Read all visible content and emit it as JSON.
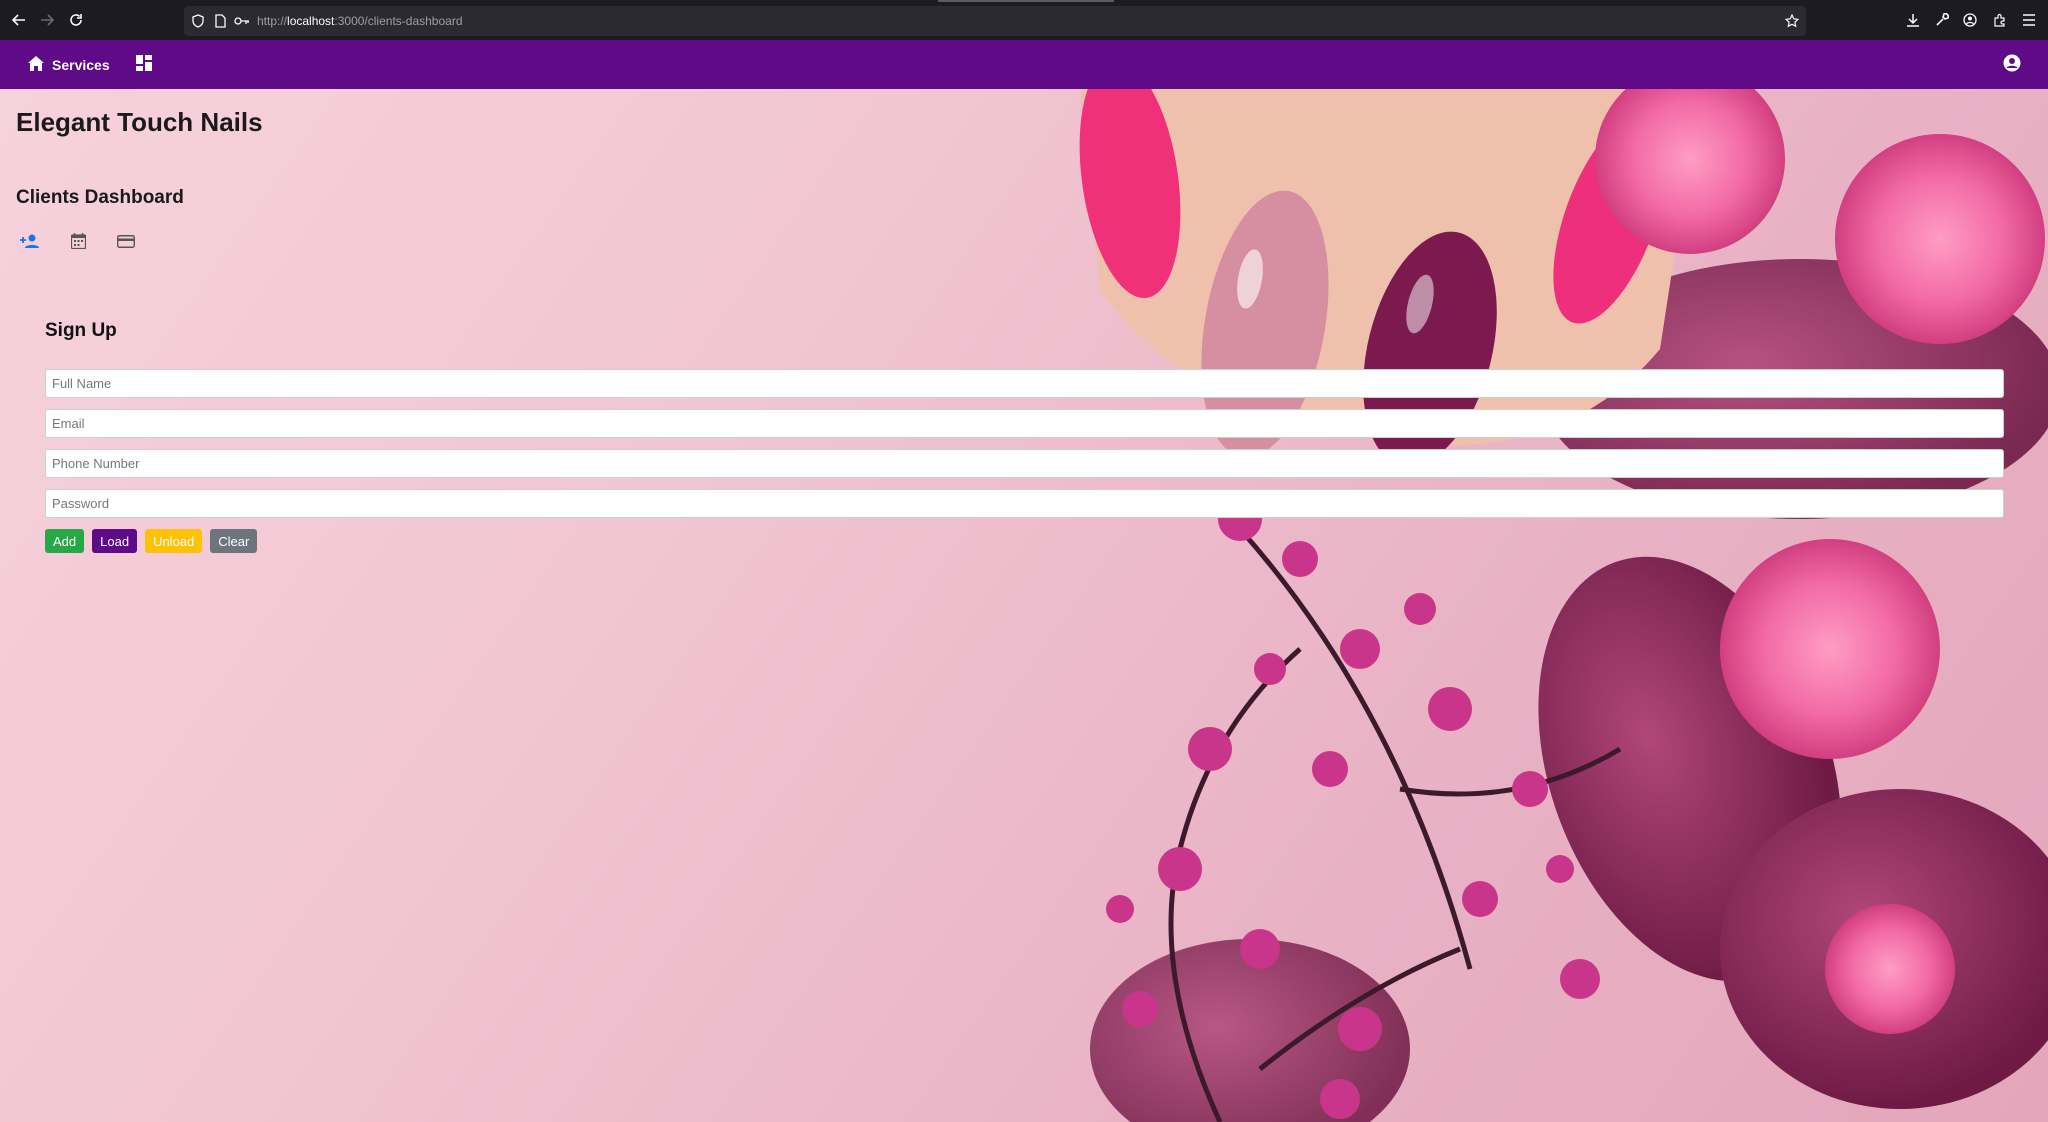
{
  "browser": {
    "url_scheme": "http://",
    "url_host": "localhost",
    "url_rest": ":3000/clients-dashboard"
  },
  "navbar": {
    "services_label": "Services",
    "color": "#5f0a87"
  },
  "page": {
    "brand": "Elegant Touch Nails",
    "dashboard_title": "Clients Dashboard",
    "dashboard_icons": [
      "person-add-icon",
      "calendar-icon",
      "credit-card-icon"
    ]
  },
  "form": {
    "title": "Sign Up",
    "fields": [
      {
        "placeholder": "Full Name",
        "value": ""
      },
      {
        "placeholder": "Email",
        "value": ""
      },
      {
        "placeholder": "Phone Number",
        "value": ""
      },
      {
        "placeholder": "Password",
        "value": ""
      }
    ],
    "buttons": {
      "add": {
        "label": "Add",
        "color": "#28a745"
      },
      "load": {
        "label": "Load",
        "color": "#5f0a87"
      },
      "unload": {
        "label": "Unload",
        "color": "#ffc107"
      },
      "clear": {
        "label": "Clear",
        "color": "#6c757d"
      }
    }
  }
}
